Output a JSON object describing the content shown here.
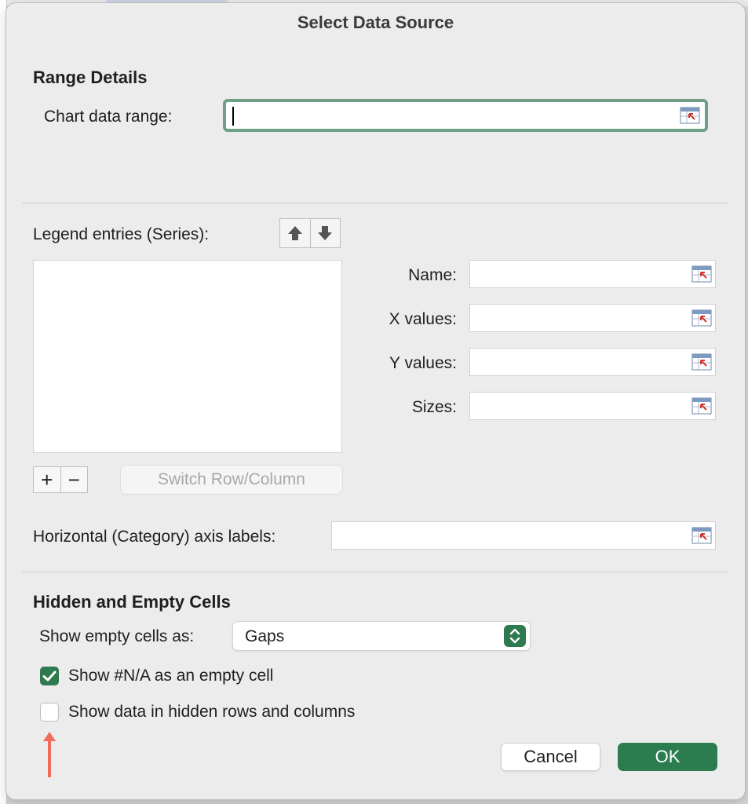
{
  "dialog": {
    "title": "Select Data Source"
  },
  "range_details": {
    "heading": "Range Details",
    "chart_data_range_label": "Chart data range:",
    "chart_data_range_value": ""
  },
  "series": {
    "legend_label": "Legend entries (Series):",
    "name_label": "Name:",
    "x_values_label": "X values:",
    "y_values_label": "Y values:",
    "sizes_label": "Sizes:",
    "add_symbol": "+",
    "remove_symbol": "−",
    "switch_label": "Switch Row/Column",
    "category_axis_label": "Horizontal (Category) axis labels:"
  },
  "hidden_empty": {
    "heading": "Hidden and Empty Cells",
    "show_empty_label": "Show empty cells as:",
    "show_empty_value": "Gaps",
    "show_na_label": "Show #N/A as an empty cell",
    "show_na_checked": true,
    "show_hidden_label": "Show data in hidden rows and columns",
    "show_hidden_checked": false
  },
  "buttons": {
    "cancel": "Cancel",
    "ok": "OK"
  },
  "colors": {
    "accent_green": "#2b7c4f",
    "focus_ring": "#6f9f85",
    "annotation_arrow": "#f06d5e"
  },
  "icons": {
    "range_picker": "range-picker-icon",
    "move_up": "arrow-up-icon",
    "move_down": "arrow-down-icon",
    "select_stepper": "chevron-updown-icon",
    "check": "checkmark-icon"
  }
}
